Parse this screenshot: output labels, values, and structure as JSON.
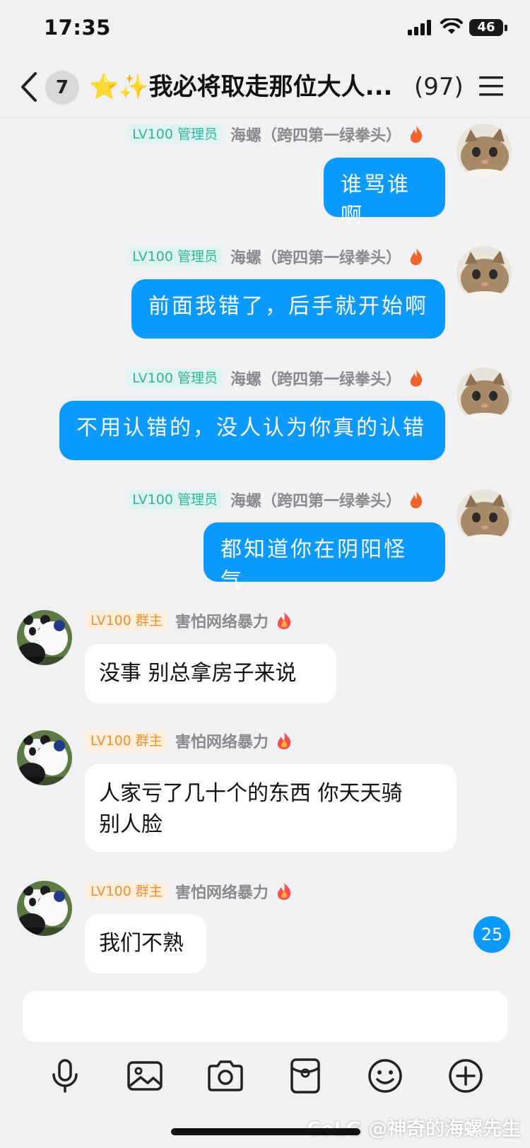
{
  "status_bar": {
    "time": "17:35",
    "battery": "46"
  },
  "header": {
    "unread": "7",
    "title": "⭐✨我必将取走那位大人...",
    "member_count": "(97)"
  },
  "messages": [
    {
      "side": "right",
      "badge": "LV100 管理员",
      "nickname": "海螺（跨四第一绿拳头）",
      "text": "谁骂谁啊"
    },
    {
      "side": "right",
      "badge": "LV100 管理员",
      "nickname": "海螺（跨四第一绿拳头）",
      "text": "前面我错了，后手就开始啊"
    },
    {
      "side": "right",
      "badge": "LV100 管理员",
      "nickname": "海螺（跨四第一绿拳头）",
      "text": "不用认错的，没人认为你真的认错"
    },
    {
      "side": "right",
      "badge": "LV100 管理员",
      "nickname": "海螺（跨四第一绿拳头）",
      "text": "都知道你在阴阳怪气"
    },
    {
      "side": "left",
      "badge": "LV100 群主",
      "nickname": "害怕网络暴力",
      "text": "没事  别总拿房子来说"
    },
    {
      "side": "left",
      "badge": "LV100 群主",
      "nickname": "害怕网络暴力",
      "text_line1": "人家亏了几十个的东西  你天天骑",
      "text_line2": "别人脸"
    },
    {
      "side": "left",
      "badge": "LV100 群主",
      "nickname": "害怕网络暴力",
      "text": "我们不熟"
    }
  ],
  "new_message_count": "25",
  "input": {
    "placeholder": "",
    "value": ""
  },
  "toolbar_icons": [
    "microphone-icon",
    "image-icon",
    "camera-icon",
    "red-packet-icon",
    "emoji-icon",
    "plus-icon"
  ],
  "watermark": "CoLG @神奇的海螺先生",
  "colors": {
    "self_bubble": "#0a99ff",
    "admin_badge": "#2fb39b",
    "owner_badge": "#f0912c"
  }
}
